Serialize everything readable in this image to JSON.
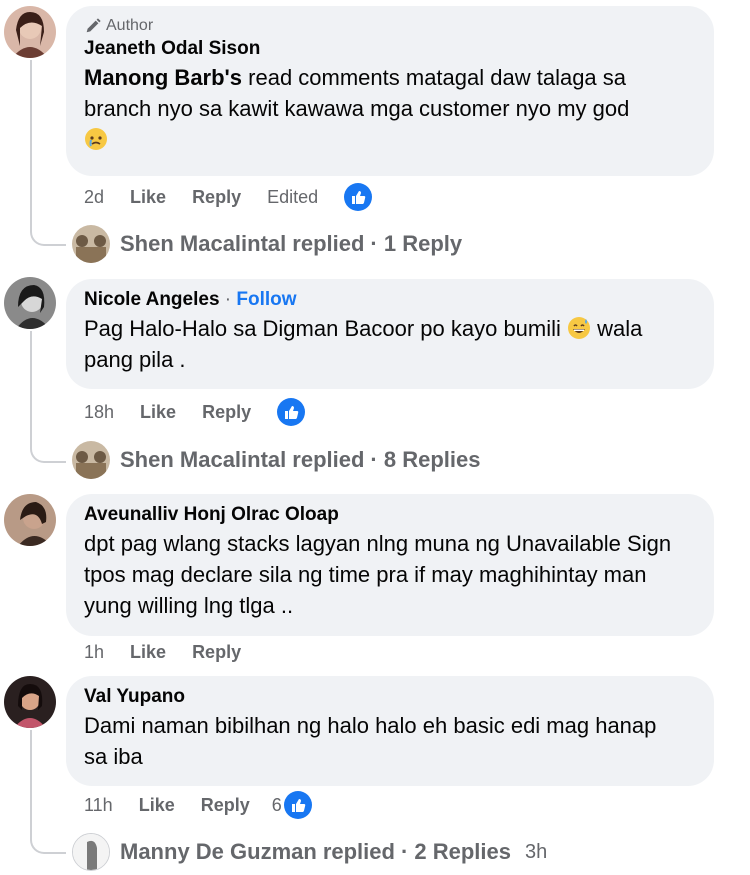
{
  "comments": [
    {
      "author_tag": "Author",
      "name": "Jeaneth Odal Sison",
      "text_bold": "Manong Barb's",
      "text": " read comments matagal daw talaga sa branch nyo sa kawit kawawa mga customer nyo my god",
      "emoji": "crying-face-emoji",
      "time": "2d",
      "like": "Like",
      "reply": "Reply",
      "edited": "Edited",
      "reactions": "",
      "replies": {
        "name": "Shen Macalintal",
        "label": "replied",
        "count": "· 1 Reply",
        "time": ""
      }
    },
    {
      "name": "Nicole Angeles",
      "sep": "·",
      "follow": "Follow",
      "text1": "Pag Halo-Halo sa Digman Bacoor po kayo bumili",
      "text2": " wala pang pila .",
      "emoji": "grinning-sweat-emoji",
      "time": "18h",
      "like": "Like",
      "reply": "Reply",
      "replies": {
        "name": "Shen Macalintal",
        "label": "replied",
        "count": "· 8 Replies",
        "time": ""
      }
    },
    {
      "name": "Aveunalliv Honj Olrac Oloap",
      "text": "dpt pag wlang stacks lagyan nlng muna ng Unavailable Sign tpos mag declare sila ng time pra if may maghihintay man yung willing lng tlga ..",
      "time": "1h",
      "like": "Like",
      "reply": "Reply"
    },
    {
      "name": "Val Yupano",
      "text": "Dami naman bibilhan ng halo halo eh basic edi mag hanap sa iba",
      "time": "11h",
      "like": "Like",
      "reply": "Reply",
      "reaction_count": "6",
      "replies": {
        "name": "Manny De Guzman",
        "label": "replied",
        "count": "· 2 Replies",
        "time": "3h"
      }
    }
  ],
  "colors": {
    "bubble": "#f0f2f5",
    "link": "#1877f2",
    "muted": "#65676b"
  }
}
